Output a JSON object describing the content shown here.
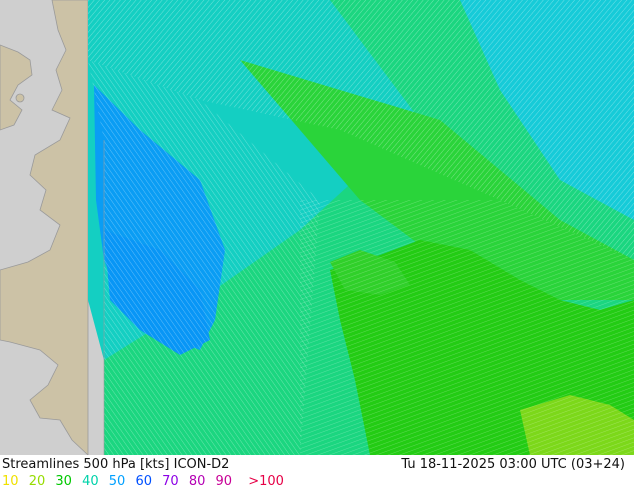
{
  "footer": {
    "title": "Streamlines 500 hPa [kts] ICON-D2",
    "datetime": "Tu 18-11-2025 03:00 UTC (03+24)"
  },
  "legend": [
    {
      "label": "10",
      "color": "#f0e100"
    },
    {
      "label": "20",
      "color": "#96dc00"
    },
    {
      "label": "30",
      "color": "#00c800"
    },
    {
      "label": "40",
      "color": "#00d2aa"
    },
    {
      "label": "50",
      "color": "#00a0ff"
    },
    {
      "label": "60",
      "color": "#0050ff"
    },
    {
      "label": "70",
      "color": "#8c00e6"
    },
    {
      "label": "80",
      "color": "#b400b4"
    },
    {
      "label": "90",
      "color": "#c80096"
    },
    {
      "label": ">100",
      "color": "#e60046"
    }
  ],
  "colors": {
    "sea": "#cfcfcf",
    "land": "#ccc2a6",
    "coast": "#9a9a9a"
  }
}
